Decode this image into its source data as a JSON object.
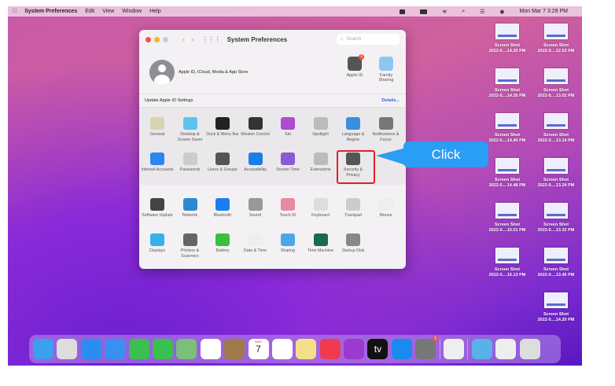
{
  "menubar": {
    "app": "System Preferences",
    "items": [
      "Edit",
      "View",
      "Window",
      "Help"
    ],
    "clock": "Mon Mar 7  3:29 PM"
  },
  "window": {
    "title": "System Preferences",
    "search_placeholder": "Search",
    "account_label": "Apple ID, iCloud, Media & App Store",
    "apple_id": {
      "label": "Apple ID",
      "badge": "1"
    },
    "family": {
      "label": "Family Sharing"
    },
    "update_label": "Update Apple ID Settings",
    "details_link": "Details..."
  },
  "prefs": [
    [
      {
        "label": "General",
        "color": "#d8d4b0"
      },
      {
        "label": "Desktop & Screen Saver",
        "color": "#5cc3ef"
      },
      {
        "label": "Dock & Menu Bar",
        "color": "#222"
      },
      {
        "label": "Mission Control",
        "color": "#333"
      },
      {
        "label": "Siri",
        "color": "#b04ad0"
      },
      {
        "label": "Spotlight",
        "color": "#bbb"
      },
      {
        "label": "Language & Region",
        "color": "#3a8ee0"
      },
      {
        "label": "Notifications & Focus",
        "color": "#777"
      }
    ],
    [
      {
        "label": "Internet Accounts",
        "color": "#2a86f0"
      },
      {
        "label": "Passwords",
        "color": "#ccc"
      },
      {
        "label": "Users & Groups",
        "color": "#555"
      },
      {
        "label": "Accessibility",
        "color": "#1a7ee8"
      },
      {
        "label": "Screen Time",
        "color": "#8a5ad0"
      },
      {
        "label": "Extensions",
        "color": "#bbb"
      },
      {
        "label": "Security & Privacy",
        "color": "#555"
      }
    ],
    [
      {
        "label": "Software Update",
        "color": "#444"
      },
      {
        "label": "Network",
        "color": "#2a8ad0"
      },
      {
        "label": "Bluetooth",
        "color": "#1a7ef0"
      },
      {
        "label": "Sound",
        "color": "#999"
      },
      {
        "label": "Touch ID",
        "color": "#e88aa0"
      },
      {
        "label": "Keyboard",
        "color": "#ddd"
      },
      {
        "label": "Trackpad",
        "color": "#ccc"
      },
      {
        "label": "Mouse",
        "color": "#eee"
      }
    ],
    [
      {
        "label": "Displays",
        "color": "#3ab0e8"
      },
      {
        "label": "Printers & Scanners",
        "color": "#666"
      },
      {
        "label": "Battery",
        "color": "#3ac03a"
      },
      {
        "label": "Date & Time",
        "color": "#eee"
      },
      {
        "label": "Sharing",
        "color": "#4aa8e8"
      },
      {
        "label": "Time Machine",
        "color": "#1a6a50"
      },
      {
        "label": "Startup Disk",
        "color": "#888"
      }
    ]
  ],
  "callout": {
    "text": "Click",
    "color": "#2a9df4"
  },
  "files": [
    {
      "name": "Screen Shot",
      "date": "2022-0....14.30 PM"
    },
    {
      "name": "Screen Shot",
      "date": "2022-0....12.52 PM"
    },
    {
      "name": "Screen Shot",
      "date": "2022-0....14.35 PM"
    },
    {
      "name": "Screen Shot",
      "date": "2022-0....13.02 PM"
    },
    {
      "name": "Screen Shot",
      "date": "2022-0....14.40 PM"
    },
    {
      "name": "Screen Shot",
      "date": "2022-0....13.14 PM"
    },
    {
      "name": "Screen Shot",
      "date": "2022-0....14.48 PM"
    },
    {
      "name": "Screen Shot",
      "date": "2022-0....13.24 PM"
    },
    {
      "name": "Screen Shot",
      "date": "2022-0....15.01 PM"
    },
    {
      "name": "Screen Shot",
      "date": "2022-0....13.32 PM"
    },
    {
      "name": "Screen Shot",
      "date": "2022-0....15.13 PM"
    },
    {
      "name": "Screen Shot",
      "date": "2022-0....13.45 PM"
    },
    null,
    {
      "name": "Screen Shot",
      "date": "2022-0....14.20 PM"
    }
  ],
  "dock": {
    "apps": [
      {
        "name": "finder",
        "color": "#3aa0f0"
      },
      {
        "name": "launchpad",
        "color": "#ddd"
      },
      {
        "name": "safari",
        "color": "#2a8ef0"
      },
      {
        "name": "mail",
        "color": "#3a90f0"
      },
      {
        "name": "facetime",
        "color": "#3ac050"
      },
      {
        "name": "messages",
        "color": "#3ac050"
      },
      {
        "name": "maps",
        "color": "#7ac07a"
      },
      {
        "name": "photos",
        "color": "#fff"
      },
      {
        "name": "contacts",
        "color": "#a07a4a"
      },
      {
        "name": "calendar",
        "color": "#fff",
        "text": "7",
        "month": "MAR"
      },
      {
        "name": "reminders",
        "color": "#fff"
      },
      {
        "name": "notes",
        "color": "#f5e08a"
      },
      {
        "name": "music",
        "color": "#f03a50"
      },
      {
        "name": "podcasts",
        "color": "#9a3ad0"
      },
      {
        "name": "tv",
        "color": "#111",
        "text": "tv"
      },
      {
        "name": "app-store",
        "color": "#1a8af0"
      },
      {
        "name": "system-preferences",
        "color": "#777",
        "badge": "1"
      }
    ],
    "recent": [
      {
        "name": "preview",
        "color": "#eee"
      }
    ],
    "others": [
      {
        "name": "downloads-folder",
        "color": "#5ab0e8"
      },
      {
        "name": "document",
        "color": "#eee"
      },
      {
        "name": "trash",
        "color": "#ddd"
      }
    ]
  }
}
